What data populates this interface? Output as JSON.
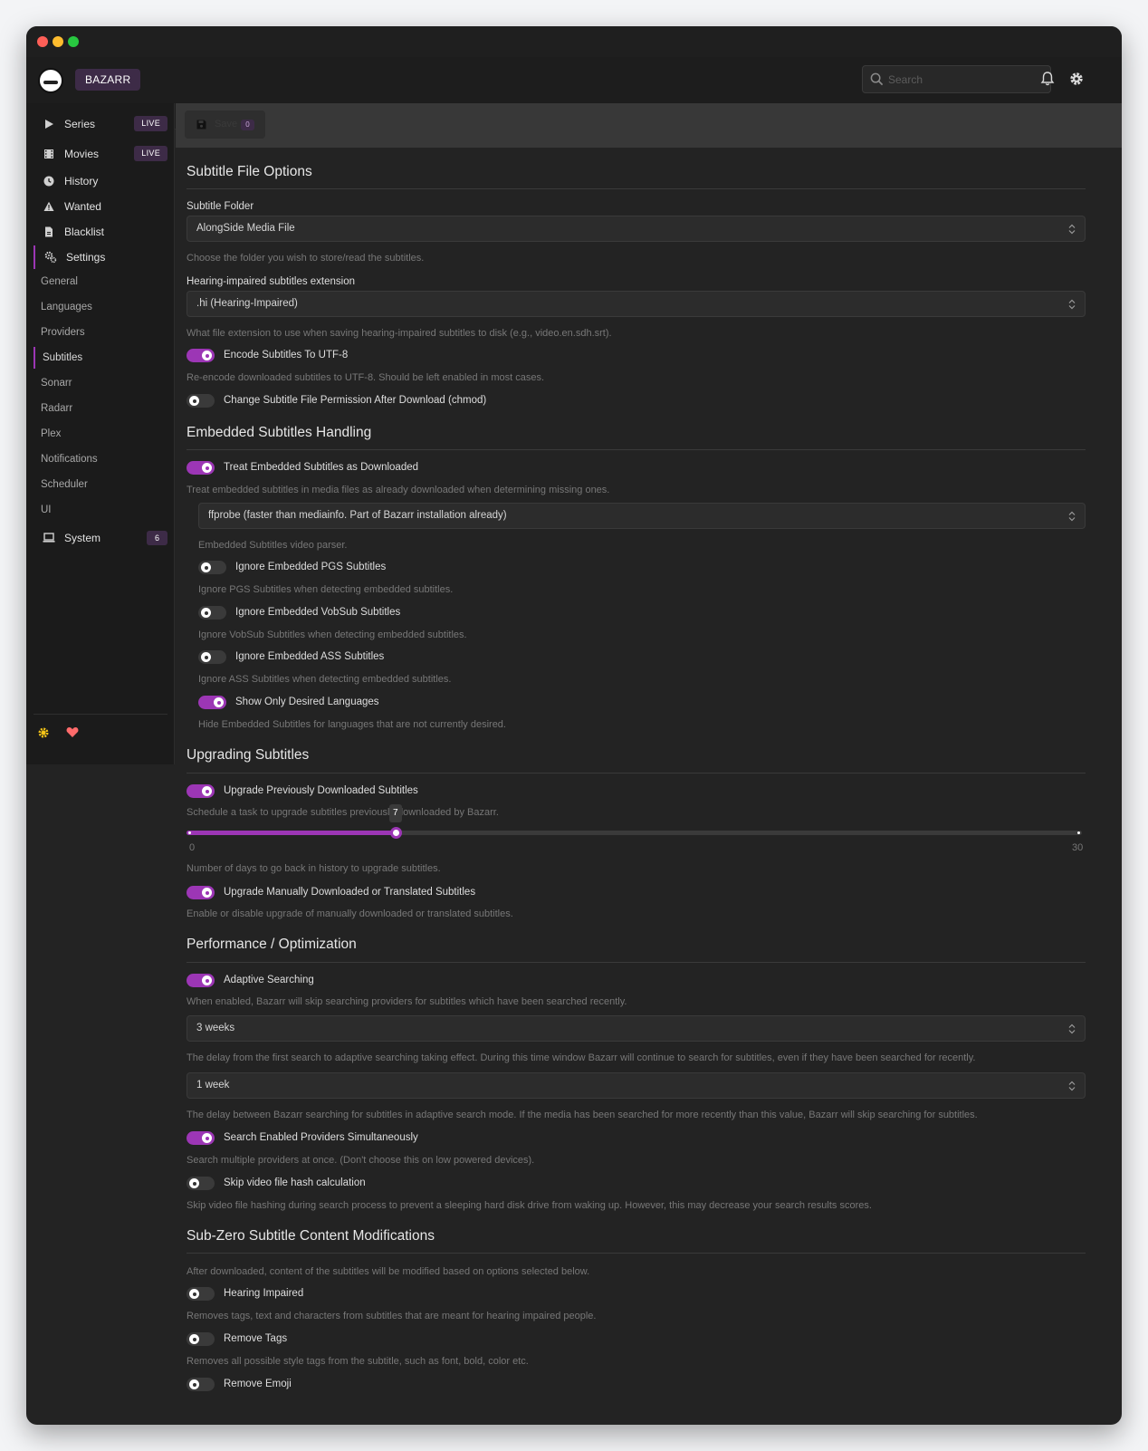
{
  "app": {
    "brand": "BAZARR"
  },
  "header": {
    "search_placeholder": "Search"
  },
  "sidebar": {
    "items": [
      {
        "label": "Series",
        "badge": "LIVE"
      },
      {
        "label": "Movies",
        "badge": "LIVE"
      },
      {
        "label": "History"
      },
      {
        "label": "Wanted"
      },
      {
        "label": "Blacklist"
      },
      {
        "label": "Settings"
      }
    ],
    "settings_items": [
      "General",
      "Languages",
      "Providers",
      "Subtitles",
      "Sonarr",
      "Radarr",
      "Plex",
      "Notifications",
      "Scheduler",
      "UI"
    ],
    "system": {
      "label": "System",
      "badge": "6"
    }
  },
  "toolbar": {
    "save_label": "Save",
    "save_count": "0"
  },
  "sections": {
    "file_options": {
      "title": "Subtitle File Options",
      "folder_label": "Subtitle Folder",
      "folder_value": "AlongSide Media File",
      "folder_desc": "Choose the folder you wish to store/read the subtitles.",
      "hi_label": "Hearing-impaired subtitles extension",
      "hi_value": ".hi (Hearing-Impaired)",
      "hi_desc": "What file extension to use when saving hearing-impaired subtitles to disk (e.g., video.en.sdh.srt).",
      "utf8_label": "Encode Subtitles To UTF-8",
      "utf8_on": true,
      "utf8_desc": "Re-encode downloaded subtitles to UTF-8. Should be left enabled in most cases.",
      "chmod_label": "Change Subtitle File Permission After Download (chmod)",
      "chmod_on": false
    },
    "embedded": {
      "title": "Embedded Subtitles Handling",
      "treat_label": "Treat Embedded Subtitles as Downloaded",
      "treat_on": true,
      "treat_desc": "Treat embedded subtitles in media files as already downloaded when determining missing ones.",
      "parser_value": "ffprobe (faster than mediainfo. Part of Bazarr installation already)",
      "parser_desc": "Embedded Subtitles video parser.",
      "pgs_label": "Ignore Embedded PGS Subtitles",
      "pgs_desc": "Ignore PGS Subtitles when detecting embedded subtitles.",
      "vobsub_label": "Ignore Embedded VobSub Subtitles",
      "vobsub_desc": "Ignore VobSub Subtitles when detecting embedded subtitles.",
      "ass_label": "Ignore Embedded ASS Subtitles",
      "ass_desc": "Ignore ASS Subtitles when detecting embedded subtitles.",
      "desired_label": "Show Only Desired Languages",
      "desired_on": true,
      "desired_desc": "Hide Embedded Subtitles for languages that are not currently desired."
    },
    "upgrading": {
      "title": "Upgrading Subtitles",
      "upgrade_label": "Upgrade Previously Downloaded Subtitles",
      "upgrade_on": true,
      "upgrade_desc": "Schedule a task to upgrade subtitles previously downloaded by Bazarr.",
      "days_value": 7,
      "days_value_label": "7",
      "days_min": 0,
      "days_max": 30,
      "days_min_label": "0",
      "days_max_label": "30",
      "days_desc": "Number of days to go back in history to upgrade subtitles.",
      "manual_label": "Upgrade Manually Downloaded or Translated Subtitles",
      "manual_on": true,
      "manual_desc": "Enable or disable upgrade of manually downloaded or translated subtitles."
    },
    "performance": {
      "title": "Performance / Optimization",
      "adaptive_label": "Adaptive Searching",
      "adaptive_on": true,
      "adaptive_desc": "When enabled, Bazarr will skip searching providers for subtitles which have been searched recently.",
      "delay1_value": "3 weeks",
      "delay1_desc": "The delay from the first search to adaptive searching taking effect. During this time window Bazarr will continue to search for subtitles, even if they have been searched for recently.",
      "delay2_value": "1 week",
      "delay2_desc": "The delay between Bazarr searching for subtitles in adaptive search mode. If the media has been searched for more recently than this value, Bazarr will skip searching for subtitles.",
      "multi_label": "Search Enabled Providers Simultaneously",
      "multi_on": true,
      "multi_desc": "Search multiple providers at once. (Don't choose this on low powered devices).",
      "hash_label": "Skip video file hash calculation",
      "hash_on": false,
      "hash_desc": "Skip video file hashing during search process to prevent a sleeping hard disk drive from waking up. However, this may decrease your search results scores."
    },
    "subzero": {
      "title": "Sub-Zero Subtitle Content Modifications",
      "intro": "After downloaded, content of the subtitles will be modified based on options selected below.",
      "hi_label": "Hearing Impaired",
      "hi_desc": "Removes tags, text and characters from subtitles that are meant for hearing impaired people.",
      "tags_label": "Remove Tags",
      "tags_desc": "Removes all possible style tags from the subtitle, such as font, bold, color etc.",
      "emoji_label": "Remove Emoji"
    }
  },
  "colors": {
    "accent": "#9c36b5",
    "badge": "#3d2b47",
    "background": "#232323"
  }
}
